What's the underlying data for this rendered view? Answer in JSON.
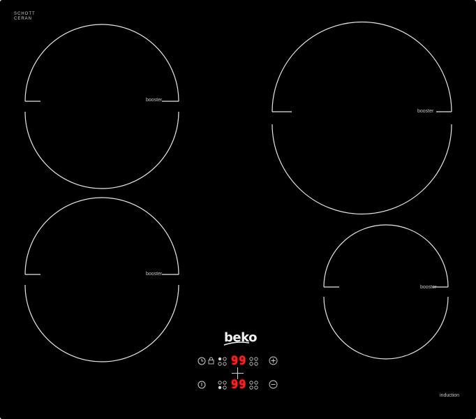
{
  "brand": {
    "glass_top": "SCHOTT",
    "glass_bottom": "CERAN",
    "logo": "beko"
  },
  "zones": [
    {
      "id": "front-left-top",
      "booster_label": "booster"
    },
    {
      "id": "rear-right",
      "booster_label": "booster"
    },
    {
      "id": "front-left-bottom",
      "booster_label": "booster"
    },
    {
      "id": "front-right",
      "booster_label": "booster"
    }
  ],
  "controls": {
    "top_display": "99",
    "bottom_display": "99",
    "icons": {
      "timer": "clock-icon",
      "lock": "lock-icon",
      "power": "power-icon",
      "plus": "plus-icon",
      "minus": "minus-icon",
      "cross": "crosshair-icon"
    },
    "display_color": "#ff2020"
  },
  "badge": {
    "induction_label": "induction"
  }
}
